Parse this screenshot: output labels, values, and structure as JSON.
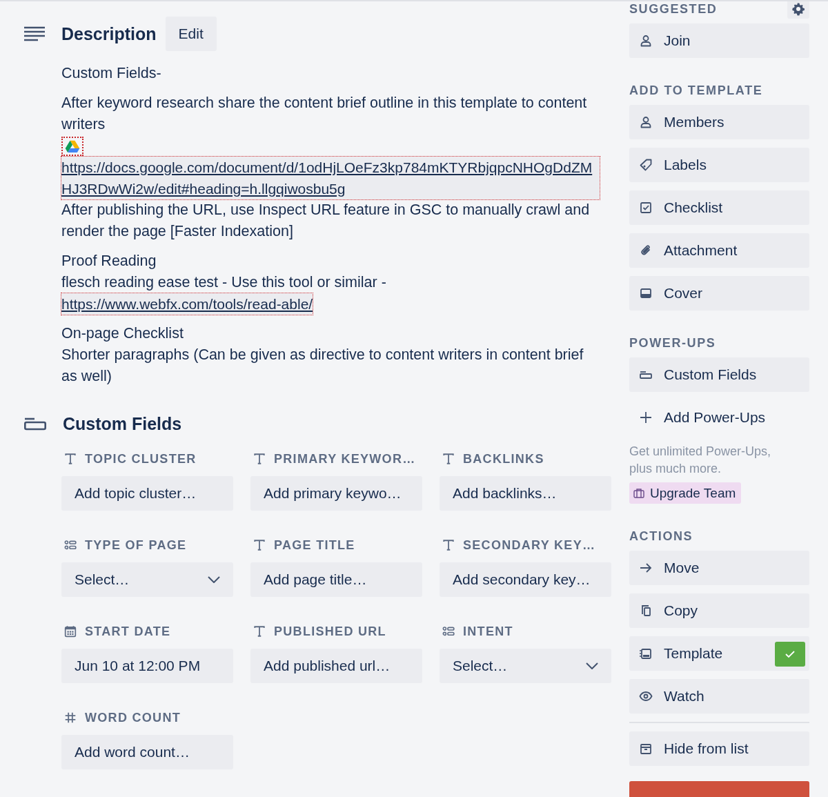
{
  "description": {
    "title": "Description",
    "edit_button": "Edit",
    "paragraphs": [
      {
        "lines": [
          {
            "kind": "text",
            "text": "Custom Fields-"
          }
        ]
      },
      {
        "lines": [
          {
            "kind": "text",
            "text": "After keyword research share the content brief outline in this template to content writers"
          },
          {
            "kind": "drive"
          },
          {
            "kind": "link",
            "text": "https://docs.google.com/document/d/1odHjLOeFz3kp784mKTYRbjqpcNHOgDdZMHJ3RDwWi2w/edit#heading=h.llgqiwosbu5g"
          },
          {
            "kind": "text",
            "text": "After publishing the URL, use Inspect URL feature in GSC to manually crawl and render the page [Faster Indexation]"
          }
        ]
      },
      {
        "lines": [
          {
            "kind": "text",
            "text": "Proof Reading"
          },
          {
            "kind": "text",
            "text": "flesch reading ease test - Use this tool or similar -"
          },
          {
            "kind": "link",
            "text": "https://www.webfx.com/tools/read-able/"
          }
        ]
      },
      {
        "lines": [
          {
            "kind": "text",
            "text": "On-page Checklist"
          },
          {
            "kind": "text",
            "text": "Shorter paragraphs (Can be given as directive to content writers in content brief as well)"
          }
        ]
      }
    ]
  },
  "custom_fields": {
    "title": "Custom Fields",
    "fields": [
      {
        "kind": "text",
        "label": "TOPIC CLUSTER",
        "placeholder": "Add topic cluster…"
      },
      {
        "kind": "text",
        "label": "PRIMARY KEYWOR…",
        "placeholder": "Add primary keywo…"
      },
      {
        "kind": "text",
        "label": "BACKLINKS",
        "placeholder": "Add backlinks…"
      },
      {
        "kind": "dropdown",
        "label": "TYPE OF PAGE",
        "placeholder": "Select…"
      },
      {
        "kind": "text",
        "label": "PAGE TITLE",
        "placeholder": "Add page title…"
      },
      {
        "kind": "text",
        "label": "SECONDARY KEY…",
        "placeholder": "Add secondary key…"
      },
      {
        "kind": "date",
        "label": "START DATE",
        "value": "Jun 10 at 12:00 PM"
      },
      {
        "kind": "text",
        "label": "PUBLISHED URL",
        "placeholder": "Add published url…"
      },
      {
        "kind": "dropdown",
        "label": "INTENT",
        "placeholder": "Select…"
      },
      {
        "kind": "number",
        "label": "WORD COUNT",
        "placeholder": "Add word count…"
      }
    ]
  },
  "sidebar": {
    "suggested": {
      "heading": "SUGGESTED",
      "items": [
        {
          "kind": "person",
          "label": "Join"
        }
      ]
    },
    "add_to_template": {
      "heading": "ADD TO TEMPLATE",
      "items": [
        {
          "kind": "person",
          "label": "Members"
        },
        {
          "kind": "label",
          "label": "Labels"
        },
        {
          "kind": "checklist",
          "label": "Checklist"
        },
        {
          "kind": "attachment",
          "label": "Attachment"
        },
        {
          "kind": "cover",
          "label": "Cover"
        }
      ]
    },
    "power_ups": {
      "heading": "POWER-UPS",
      "items": [
        {
          "kind": "fields",
          "label": "Custom Fields"
        },
        {
          "kind": "add",
          "label": "Add Power-Ups"
        }
      ],
      "promo": "Get unlimited Power-Ups, plus much more.",
      "upgrade_button": "Upgrade Team"
    },
    "actions": {
      "heading": "ACTIONS",
      "items": [
        {
          "kind": "move",
          "label": "Move"
        },
        {
          "kind": "copy",
          "label": "Copy"
        },
        {
          "kind": "template",
          "label": "Template",
          "checked": true
        },
        {
          "kind": "watch",
          "label": "Watch"
        },
        {
          "kind": "hide",
          "label": "Hide from list"
        }
      ]
    }
  }
}
